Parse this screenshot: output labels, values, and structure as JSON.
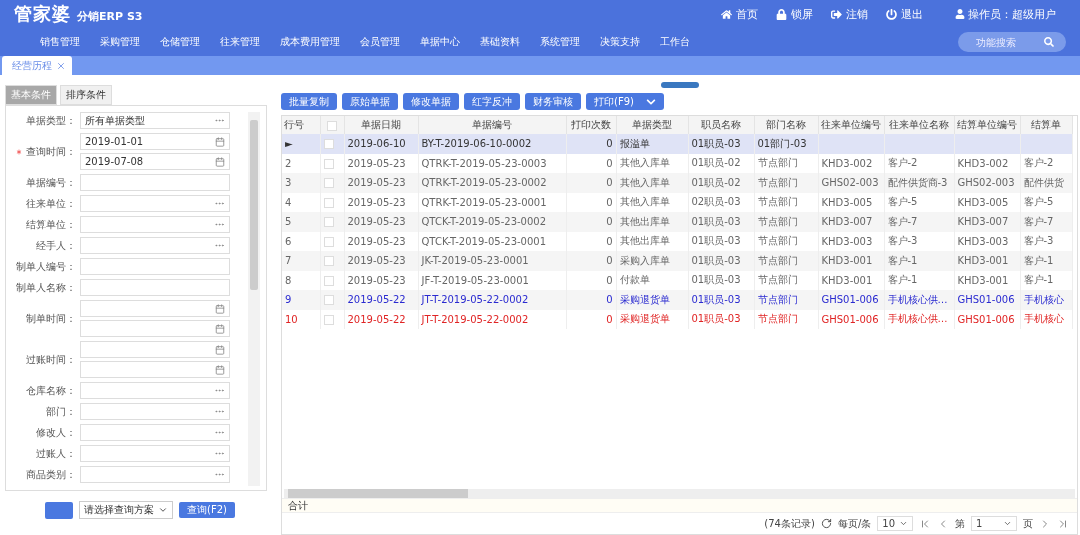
{
  "header": {
    "logo": "管家婆",
    "product": "分销ERP S3",
    "links": [
      {
        "kind": "home",
        "label": "首页"
      },
      {
        "kind": "lock",
        "label": "锁屏"
      },
      {
        "kind": "logout",
        "label": "注销"
      },
      {
        "kind": "power",
        "label": "退出"
      }
    ],
    "operator": "操作员：超级用户"
  },
  "nav": {
    "items": [
      "销售管理",
      "采购管理",
      "仓储管理",
      "往来管理",
      "成本费用管理",
      "会员管理",
      "单据中心",
      "基础资料",
      "系统管理",
      "决策支持",
      "工作台"
    ],
    "search_placeholder": "功能搜索"
  },
  "page_tabs": [
    {
      "label": "经营历程",
      "selected": true
    }
  ],
  "filter": {
    "tabs": [
      {
        "label": "基本条件",
        "selected": true
      },
      {
        "label": "排序条件",
        "selected": false
      }
    ],
    "fields": [
      {
        "label": "单据类型：",
        "required": false,
        "inputs": [
          {
            "kind": "picker",
            "value": "所有单据类型"
          }
        ]
      },
      {
        "label": "查询时间：",
        "required": true,
        "inputs": [
          {
            "kind": "date",
            "value": "2019-01-01"
          },
          {
            "kind": "date",
            "value": "2019-07-08"
          }
        ]
      },
      {
        "label": "单据编号：",
        "required": false,
        "inputs": [
          {
            "kind": "text"
          }
        ]
      },
      {
        "label": "往来单位：",
        "required": false,
        "inputs": [
          {
            "kind": "picker"
          }
        ]
      },
      {
        "label": "结算单位：",
        "required": false,
        "inputs": [
          {
            "kind": "picker"
          }
        ]
      },
      {
        "label": "经手人：",
        "required": false,
        "inputs": [
          {
            "kind": "picker"
          }
        ]
      },
      {
        "label": "制单人编号：",
        "required": false,
        "inputs": [
          {
            "kind": "text"
          }
        ]
      },
      {
        "label": "制单人名称：",
        "required": false,
        "inputs": [
          {
            "kind": "text"
          }
        ]
      },
      {
        "label": "制单时间：",
        "required": false,
        "inputs": [
          {
            "kind": "date"
          },
          {
            "kind": "date"
          }
        ]
      },
      {
        "label": "过账时间：",
        "required": false,
        "inputs": [
          {
            "kind": "date"
          },
          {
            "kind": "date"
          }
        ]
      },
      {
        "label": "仓库名称：",
        "required": false,
        "inputs": [
          {
            "kind": "picker"
          }
        ]
      },
      {
        "label": "部门：",
        "required": false,
        "inputs": [
          {
            "kind": "picker"
          }
        ]
      },
      {
        "label": "修改人：",
        "required": false,
        "inputs": [
          {
            "kind": "picker"
          }
        ]
      },
      {
        "label": "过账人：",
        "required": false,
        "inputs": [
          {
            "kind": "picker"
          }
        ]
      },
      {
        "label": "商品类别：",
        "required": false,
        "inputs": [
          {
            "kind": "picker"
          }
        ]
      }
    ],
    "scheme": "请选择查询方案",
    "query_button": "查询(F2)"
  },
  "toolbar": [
    "批量复制",
    "原始单据",
    "修改单据",
    "红字反冲",
    "财务审核"
  ],
  "print_button": "打印(F9)",
  "table": {
    "columns": [
      "行号",
      "",
      "单据日期",
      "单据编号",
      "打印次数",
      "单据类型",
      "职员名称",
      "部门名称",
      "往来单位编号",
      "往来单位名称",
      "结算单位编号",
      "结算单"
    ],
    "all_checked": false,
    "rows": [
      {
        "selected": true,
        "color": "#333333",
        "cells": [
          "►",
          "",
          "2019-06-10",
          "BY-T-2019-06-10-0002",
          "0",
          "报溢单",
          "01职员-03",
          "01部门-03",
          "",
          "",
          "",
          ""
        ]
      },
      {
        "selected": false,
        "color": "#666666",
        "cells": [
          "2",
          "",
          "2019-05-23",
          "QTRK-T-2019-05-23-0003",
          "0",
          "其他入库单",
          "01职员-02",
          "节点部门",
          "KHD3-002",
          "客户-2",
          "KHD3-002",
          "客户-2"
        ]
      },
      {
        "selected": false,
        "color": "#666666",
        "cells": [
          "3",
          "",
          "2019-05-23",
          "QTRK-T-2019-05-23-0002",
          "0",
          "其他入库单",
          "01职员-02",
          "节点部门",
          "GHS02-003",
          "配件供货商-3",
          "GHS02-003",
          "配件供货"
        ]
      },
      {
        "selected": false,
        "color": "#666666",
        "cells": [
          "4",
          "",
          "2019-05-23",
          "QTRK-T-2019-05-23-0001",
          "0",
          "其他入库单",
          "02职员-03",
          "节点部门",
          "KHD3-005",
          "客户-5",
          "KHD3-005",
          "客户-5"
        ]
      },
      {
        "selected": false,
        "color": "#666666",
        "cells": [
          "5",
          "",
          "2019-05-23",
          "QTCK-T-2019-05-23-0002",
          "0",
          "其他出库单",
          "01职员-03",
          "节点部门",
          "KHD3-007",
          "客户-7",
          "KHD3-007",
          "客户-7"
        ]
      },
      {
        "selected": false,
        "color": "#666666",
        "cells": [
          "6",
          "",
          "2019-05-23",
          "QTCK-T-2019-05-23-0001",
          "0",
          "其他出库单",
          "01职员-03",
          "节点部门",
          "KHD3-003",
          "客户-3",
          "KHD3-003",
          "客户-3"
        ]
      },
      {
        "selected": false,
        "color": "#666666",
        "cells": [
          "7",
          "",
          "2019-05-23",
          "JK-T-2019-05-23-0001",
          "0",
          "采购入库单",
          "01职员-03",
          "节点部门",
          "KHD3-001",
          "客户-1",
          "KHD3-001",
          "客户-1"
        ]
      },
      {
        "selected": false,
        "color": "#666666",
        "cells": [
          "8",
          "",
          "2019-05-23",
          "JF-T-2019-05-23-0001",
          "0",
          "付款单",
          "01职员-03",
          "节点部门",
          "KHD3-001",
          "客户-1",
          "KHD3-001",
          "客户-1"
        ]
      },
      {
        "selected": false,
        "color": "#2a2ad0",
        "cells": [
          "9",
          "",
          "2019-05-22",
          "JT-T-2019-05-22-0002",
          "0",
          "采购退货单",
          "01职员-03",
          "节点部门",
          "GHS01-006",
          "手机核心供…",
          "GHS01-006",
          "手机核心"
        ]
      },
      {
        "selected": false,
        "color": "#e02424",
        "cells": [
          "10",
          "",
          "2019-05-22",
          "JT-T-2019-05-22-0002",
          "0",
          "采购退货单",
          "01职员-03",
          "节点部门",
          "GHS01-006",
          "手机核心供…",
          "GHS01-006",
          "手机核心"
        ]
      }
    ],
    "total_label": "合计"
  },
  "pager": {
    "records": "(74条记录)",
    "per_page_label": "每页/条",
    "per_page": "10",
    "page_prefix": "第",
    "page": "1",
    "page_suffix": "页"
  }
}
